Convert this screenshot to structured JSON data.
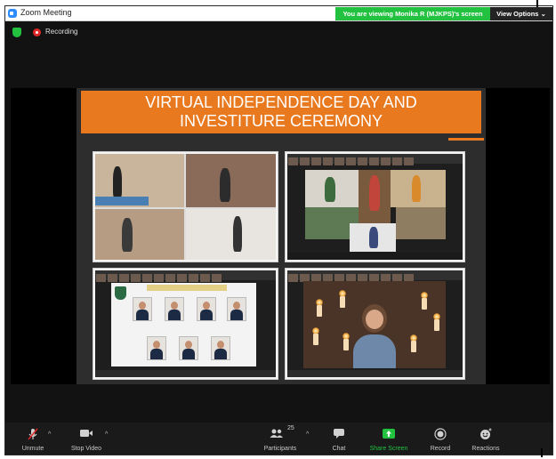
{
  "window": {
    "title": "Zoom Meeting"
  },
  "banner": {
    "viewing_text": "You are viewing Monika R (MJKPS)'s screen",
    "view_options": "View Options"
  },
  "status": {
    "recording_label": "Recording"
  },
  "slide": {
    "title_line1": "VIRTUAL INDEPENDENCE DAY AND",
    "title_line2": "INVESTITURE CEREMONY"
  },
  "toolbar": {
    "unmute": "Unmute",
    "stop_video": "Stop Video",
    "participants": "Participants",
    "participants_count": "25",
    "chat": "Chat",
    "share_screen": "Share Screen",
    "record": "Record",
    "reactions": "Reactions"
  },
  "colors": {
    "banner_green": "#23c140",
    "slide_orange": "#e8791f",
    "toolbar_bg": "#1a1a1a",
    "recording_red": "#e02828"
  }
}
